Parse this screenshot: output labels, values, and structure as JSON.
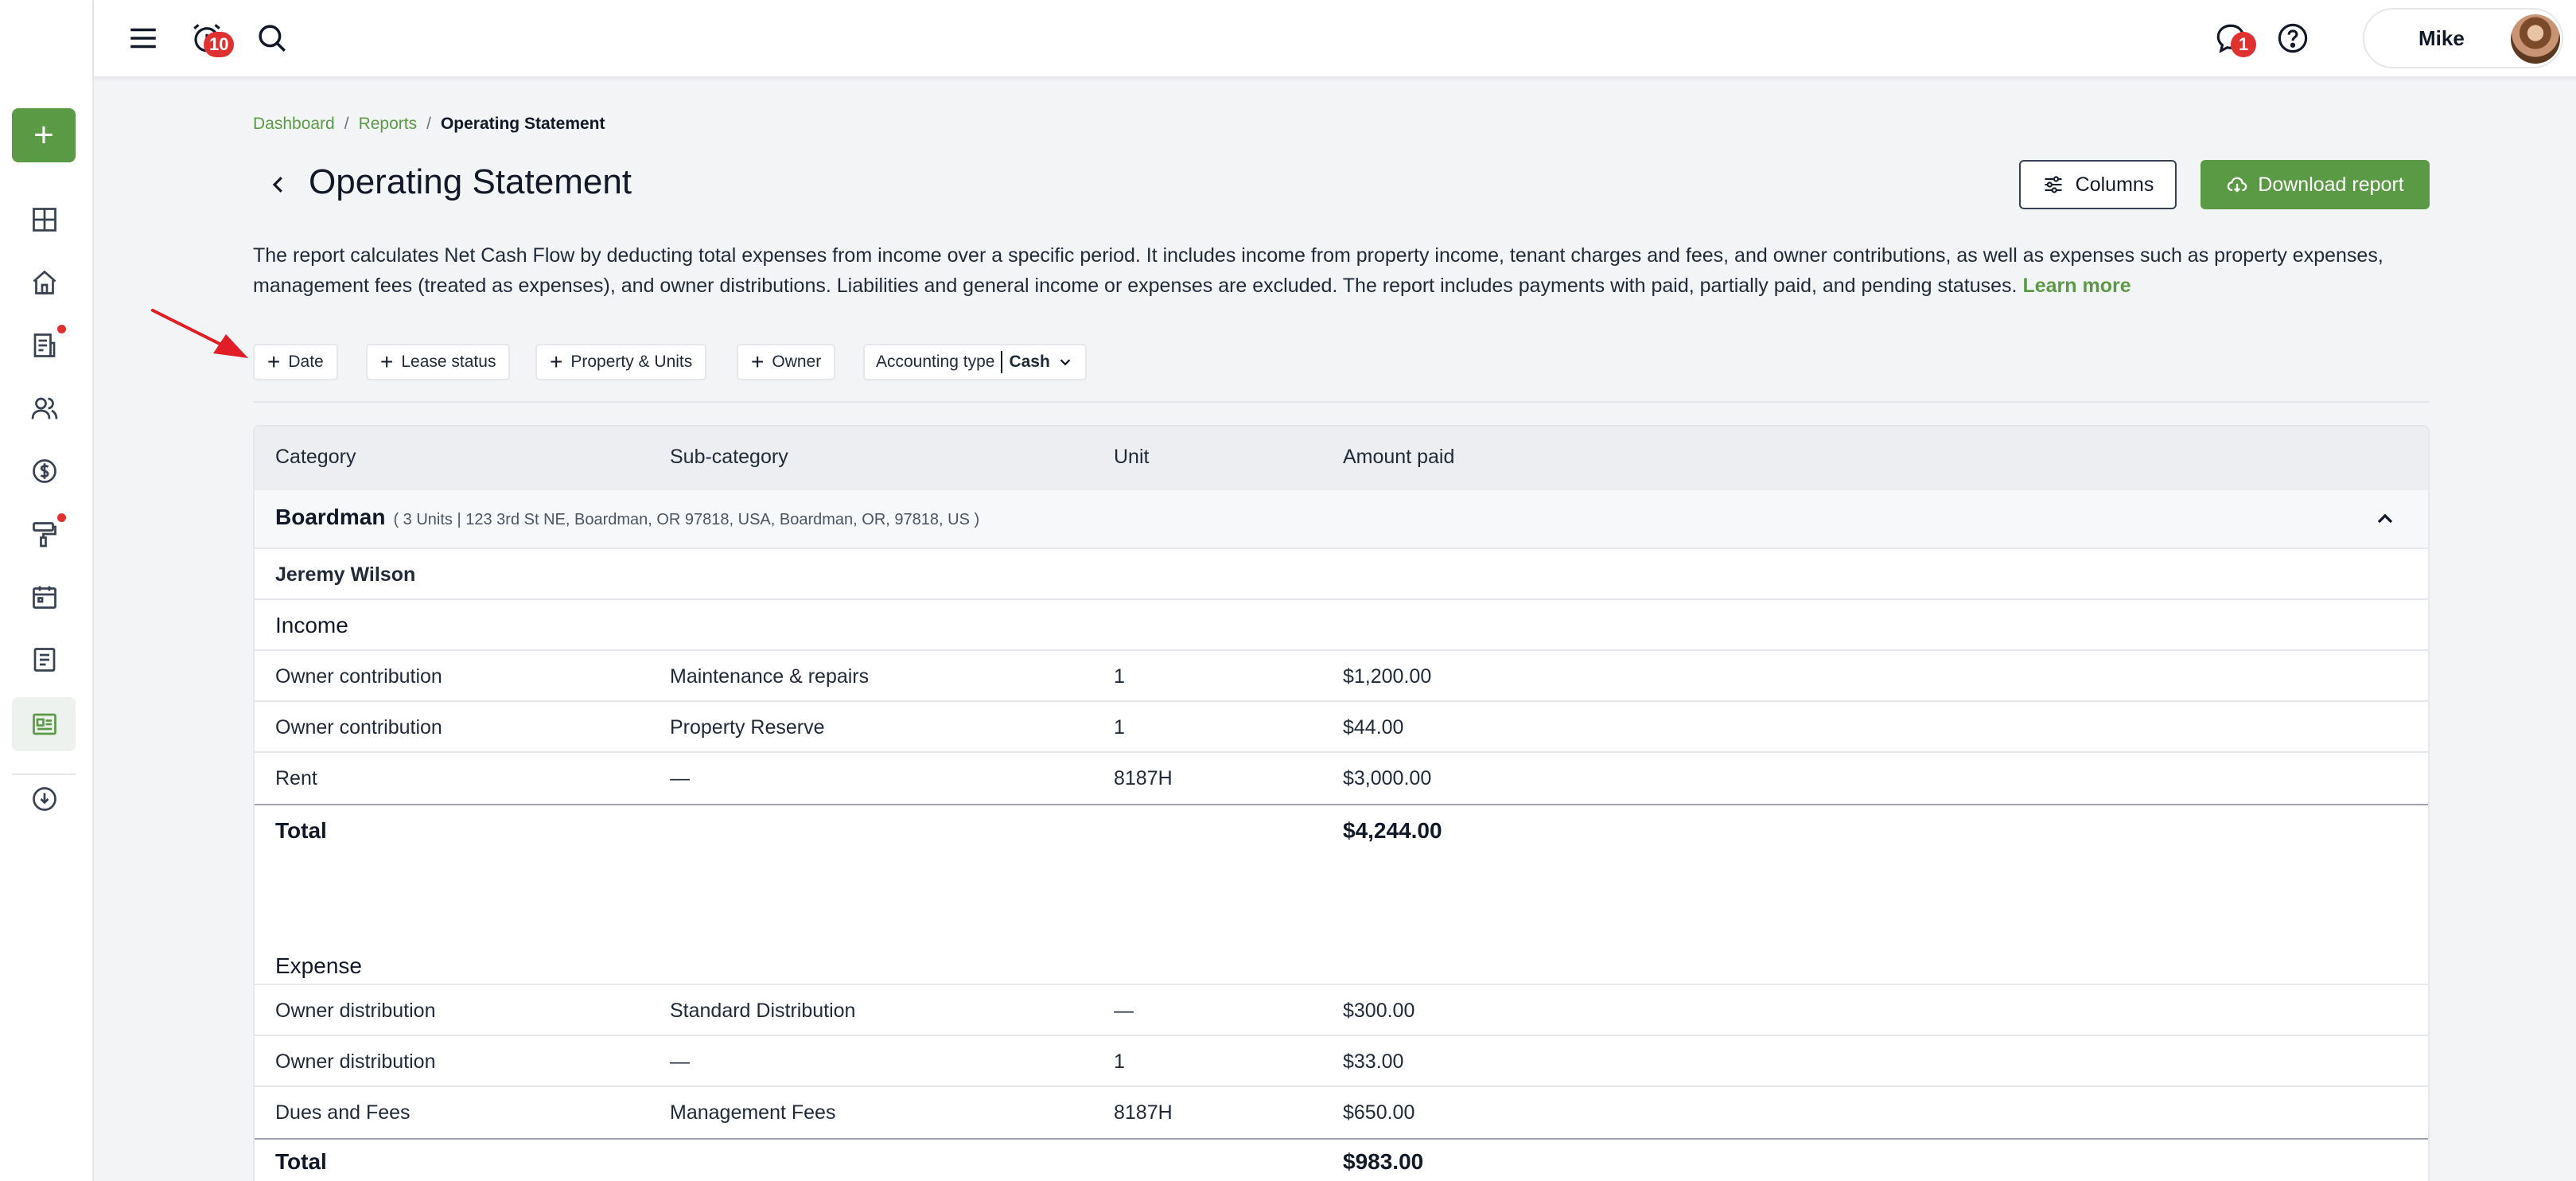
{
  "topbar": {
    "notifications_count": "10",
    "messages_count": "1",
    "user_name": "Mike"
  },
  "breadcrumb": {
    "items": [
      "Dashboard",
      "Reports"
    ],
    "current": "Operating Statement"
  },
  "page": {
    "title": "Operating Statement",
    "columns_label": "Columns",
    "download_label": "Download report",
    "description": "The report calculates Net Cash Flow by deducting total expenses from income over a specific period. It includes income from property income, tenant charges and fees, and owner contributions, as well as expenses such as property expenses, management fees (treated as expenses), and owner distributions. Liabilities and general income or expenses are excluded. The report includes payments with paid, partially paid, and pending statuses.",
    "learn_more": "Learn more"
  },
  "filters": {
    "date": "Date",
    "lease_status": "Lease status",
    "property_units": "Property & Units",
    "owner": "Owner",
    "accounting_type_label": "Accounting type",
    "accounting_type_value": "Cash"
  },
  "table": {
    "headers": [
      "Category",
      "Sub-category",
      "Unit",
      "Amount paid"
    ],
    "property": {
      "name": "Boardman",
      "meta": "( 3 Units | 123 3rd St NE, Boardman, OR 97818, USA, Boardman, OR, 97818, US )"
    },
    "owner_name": "Jeremy Wilson",
    "income": {
      "title": "Income",
      "rows": [
        [
          "Owner contribution",
          "Maintenance & repairs",
          "1",
          "$1,200.00"
        ],
        [
          "Owner contribution",
          "Property Reserve",
          "1",
          "$44.00"
        ],
        [
          "Rent",
          "—",
          "8187H",
          "$3,000.00"
        ]
      ],
      "total_label": "Total",
      "total_value": "$4,244.00"
    },
    "expense": {
      "title": "Expense",
      "rows": [
        [
          "Owner distribution",
          "Standard Distribution",
          "—",
          "$300.00"
        ],
        [
          "Owner distribution",
          "—",
          "1",
          "$33.00"
        ],
        [
          "Dues and Fees",
          "Management Fees",
          "8187H",
          "$650.00"
        ]
      ],
      "total_label": "Total",
      "total_value": "$983.00"
    }
  },
  "colors": {
    "accent": "#5a9a45",
    "badge": "#e03131",
    "arrow": "#e11d28"
  },
  "icons": {
    "sidebar": [
      "plus-icon",
      "dashboard-icon",
      "home-icon",
      "leases-icon",
      "people-icon",
      "dollar-icon",
      "maintenance-icon",
      "calendar-icon",
      "document-icon",
      "reports-icon",
      "cloud-download-icon"
    ],
    "topbar": [
      "menu-icon",
      "alarm-icon",
      "search-icon",
      "chat-icon",
      "help-icon"
    ]
  }
}
